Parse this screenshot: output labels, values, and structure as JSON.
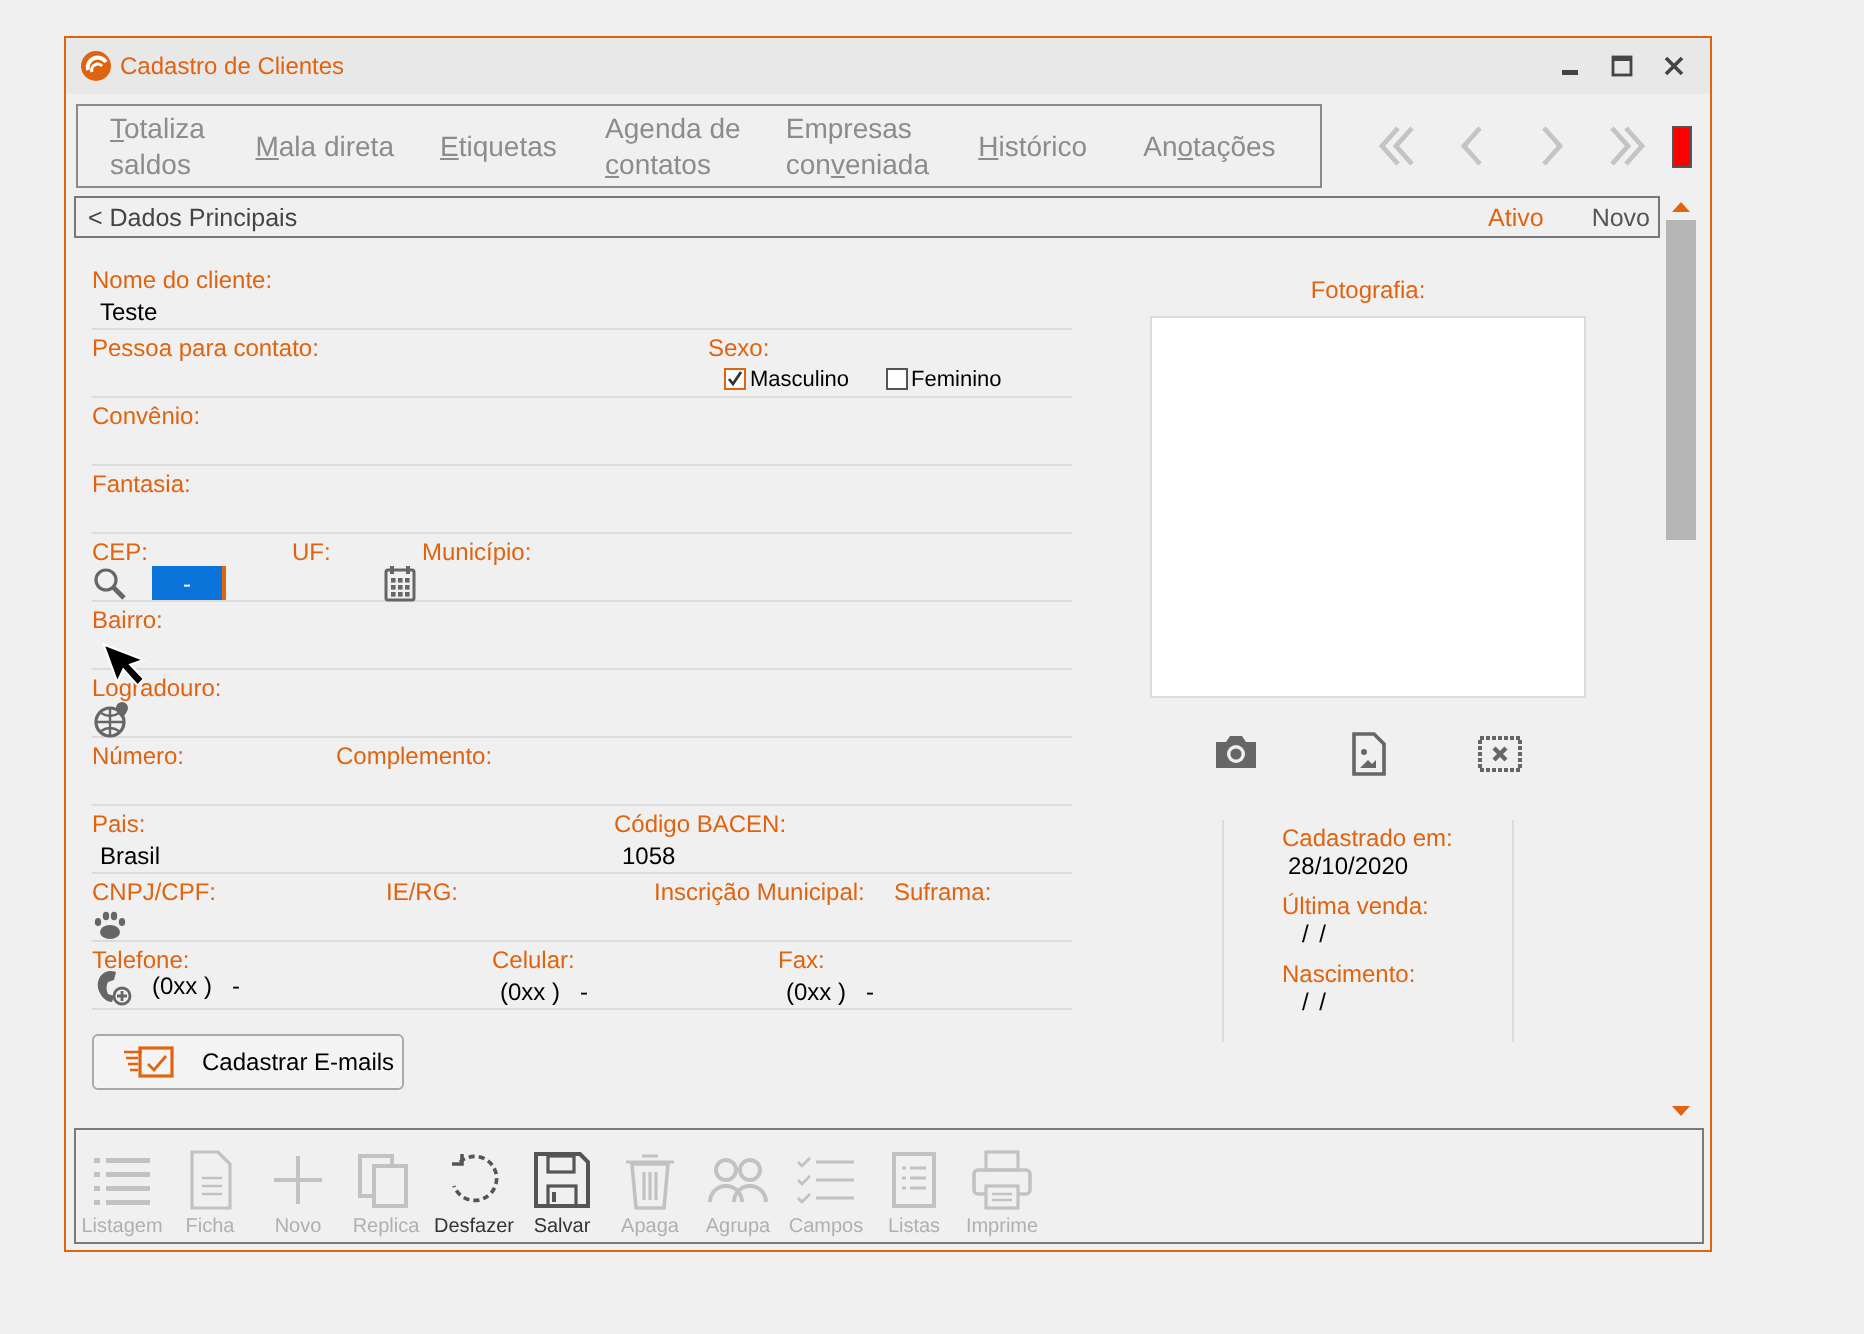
{
  "window": {
    "title": "Cadastro de Clientes"
  },
  "menu": [
    {
      "hotkey": "T",
      "after": "otaliza saldos"
    },
    {
      "hotkey": "M",
      "after": "ala direta"
    },
    {
      "hotkey": "E",
      "after": "tiquetas"
    },
    {
      "before": "Agenda de ",
      "hotkey": "c",
      "after": "ontatos"
    },
    {
      "before": "Empresas con",
      "hotkey": "v",
      "after": "eniada"
    },
    {
      "hotkey": "H",
      "after": "istórico"
    },
    {
      "before": "An",
      "hotkey": "o",
      "after": "tações"
    }
  ],
  "breadcrumb": {
    "section": "< Dados Principais",
    "status": "Ativo",
    "mode": "Novo"
  },
  "form": {
    "rows": [
      {
        "fields": [
          {
            "kind": "text",
            "label": "Nome do cliente:",
            "value": "Teste"
          }
        ]
      },
      {
        "fields": [
          {
            "kind": "text",
            "label": "Pessoa para contato:"
          },
          {
            "kind": "choice",
            "label": "Sexo:",
            "options": [
              {
                "label": "Masculino",
                "checked": true
              },
              {
                "label": "Feminino",
                "checked": false
              }
            ]
          }
        ]
      },
      {
        "fields": [
          {
            "kind": "text",
            "label": "Convênio:"
          }
        ]
      },
      {
        "fields": [
          {
            "kind": "text",
            "label": "Fantasia:"
          }
        ]
      },
      {
        "fields": [
          {
            "kind": "cep",
            "label": "CEP:",
            "value": "-"
          },
          {
            "kind": "uf",
            "label": "UF:"
          },
          {
            "kind": "text",
            "label": "Município:"
          }
        ]
      },
      {
        "fields": [
          {
            "kind": "text",
            "label": "Bairro:"
          }
        ]
      },
      {
        "fields": [
          {
            "kind": "street",
            "label": "Logradouro:"
          }
        ]
      },
      {
        "fields": [
          {
            "kind": "text",
            "label": "Número:"
          },
          {
            "kind": "text",
            "label": "Complemento:"
          }
        ]
      },
      {
        "fields": [
          {
            "kind": "text",
            "label": "Pais:",
            "value": "Brasil"
          },
          {
            "kind": "text",
            "label": "Código BACEN:",
            "value": "1058"
          }
        ]
      },
      {
        "fields": [
          {
            "kind": "document",
            "label": "CNPJ/CPF:"
          },
          {
            "kind": "text",
            "label": "IE/RG:"
          },
          {
            "kind": "text",
            "label": "Inscrição Municipal:"
          },
          {
            "kind": "text",
            "label": "Suframa:"
          }
        ]
      },
      {
        "fields": [
          {
            "kind": "phone",
            "label": "Telefone:",
            "value": "(0xx )   -"
          },
          {
            "kind": "text",
            "label": "Celular:",
            "value": "(0xx )   -"
          },
          {
            "kind": "text",
            "label": "Fax:",
            "value": "(0xx )   -"
          }
        ]
      }
    ],
    "email_button": "Cadastrar E-mails"
  },
  "photo": {
    "label": "Fotografia:"
  },
  "dates": [
    {
      "label": "Cadastrado em:",
      "value": "28/10/2020"
    },
    {
      "label": "Última venda:",
      "value": "/ /"
    },
    {
      "label": "Nascimento:",
      "value": "/ /"
    }
  ],
  "toolbar": [
    {
      "label": "Listagem",
      "disabled": true
    },
    {
      "label": "Ficha",
      "disabled": true
    },
    {
      "label": "Novo",
      "disabled": true
    },
    {
      "label": "Replica",
      "disabled": true
    },
    {
      "label": "Desfazer",
      "disabled": false
    },
    {
      "label": "Salvar",
      "disabled": false
    },
    {
      "label": "Apaga",
      "disabled": true
    },
    {
      "label": "Agrupa",
      "disabled": true
    },
    {
      "label": "Campos",
      "disabled": true
    },
    {
      "label": "Listas",
      "disabled": true
    },
    {
      "label": "Imprime",
      "disabled": true
    }
  ]
}
